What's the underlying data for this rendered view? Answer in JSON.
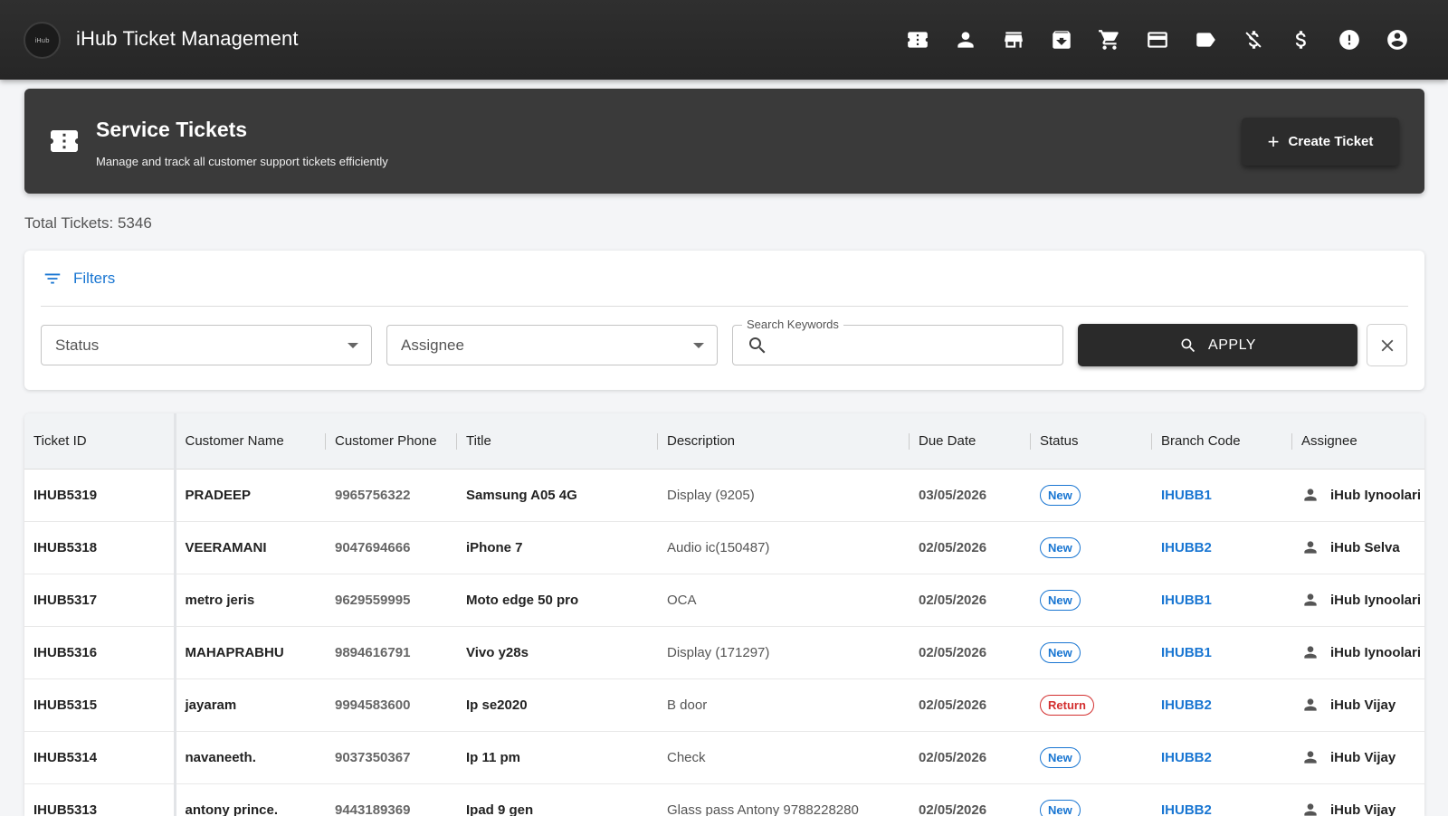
{
  "app": {
    "logo_text": "iHub",
    "title": "iHub Ticket Management"
  },
  "nav": [
    {
      "name": "nav-tickets",
      "icon": "ticket-icon"
    },
    {
      "name": "nav-customers",
      "icon": "person-icon"
    },
    {
      "name": "nav-stores",
      "icon": "store-icon"
    },
    {
      "name": "nav-inventory",
      "icon": "archive-icon"
    },
    {
      "name": "nav-cart",
      "icon": "cart-icon"
    },
    {
      "name": "nav-payments",
      "icon": "credit-card-icon"
    },
    {
      "name": "nav-tags",
      "icon": "tag-icon"
    },
    {
      "name": "nav-no-money",
      "icon": "money-off-icon"
    },
    {
      "name": "nav-money",
      "icon": "dollar-icon"
    },
    {
      "name": "nav-alerts",
      "icon": "alert-icon"
    },
    {
      "name": "nav-account",
      "icon": "account-circle-icon"
    }
  ],
  "hero": {
    "title": "Service Tickets",
    "subtitle": "Manage and track all customer support tickets efficiently",
    "create_label": "Create Ticket"
  },
  "total_label": "Total Tickets: 5346",
  "filters": {
    "title": "Filters",
    "status_placeholder": "Status",
    "assignee_placeholder": "Assignee",
    "search_label": "Search Keywords",
    "search_value": "",
    "apply_label": "APPLY"
  },
  "table": {
    "columns": [
      "Ticket ID",
      "Customer Name",
      "Customer Phone",
      "Title",
      "Description",
      "Due Date",
      "Status",
      "Branch Code",
      "Assignee"
    ],
    "rows": [
      {
        "id": "IHUB5319",
        "name": "PRADEEP",
        "phone": "9965756322",
        "title": "Samsung A05 4G",
        "desc": "Display (9205)",
        "due": "03/05/2026",
        "status": "New",
        "branch": "IHUBB1",
        "assignee": "iHub Iynoolari"
      },
      {
        "id": "IHUB5318",
        "name": "VEERAMANI",
        "phone": "9047694666",
        "title": "iPhone 7",
        "desc": "Audio ic(150487)",
        "due": "02/05/2026",
        "status": "New",
        "branch": "IHUBB2",
        "assignee": "iHub Selva"
      },
      {
        "id": "IHUB5317",
        "name": "metro jeris",
        "phone": "9629559995",
        "title": "Moto edge 50 pro",
        "desc": "OCA",
        "due": "02/05/2026",
        "status": "New",
        "branch": "IHUBB1",
        "assignee": "iHub Iynoolari"
      },
      {
        "id": "IHUB5316",
        "name": "MAHAPRABHU",
        "phone": "9894616791",
        "title": "Vivo y28s",
        "desc": "Display (171297)",
        "due": "02/05/2026",
        "status": "New",
        "branch": "IHUBB1",
        "assignee": "iHub Iynoolari"
      },
      {
        "id": "IHUB5315",
        "name": "jayaram",
        "phone": "9994583600",
        "title": "Ip se2020",
        "desc": "B door",
        "due": "02/05/2026",
        "status": "Return",
        "branch": "IHUBB2",
        "assignee": "iHub Vijay"
      },
      {
        "id": "IHUB5314",
        "name": "navaneeth.",
        "phone": "9037350367",
        "title": "Ip 11 pm",
        "desc": "Check",
        "due": "02/05/2026",
        "status": "New",
        "branch": "IHUBB2",
        "assignee": "iHub Vijay"
      },
      {
        "id": "IHUB5313",
        "name": "antony prince.",
        "phone": "9443189369",
        "title": "Ipad 9 gen",
        "desc": "Glass pass Antony 9788228280",
        "due": "02/05/2026",
        "status": "New",
        "branch": "IHUBB2",
        "assignee": "iHub Vijay"
      }
    ]
  }
}
